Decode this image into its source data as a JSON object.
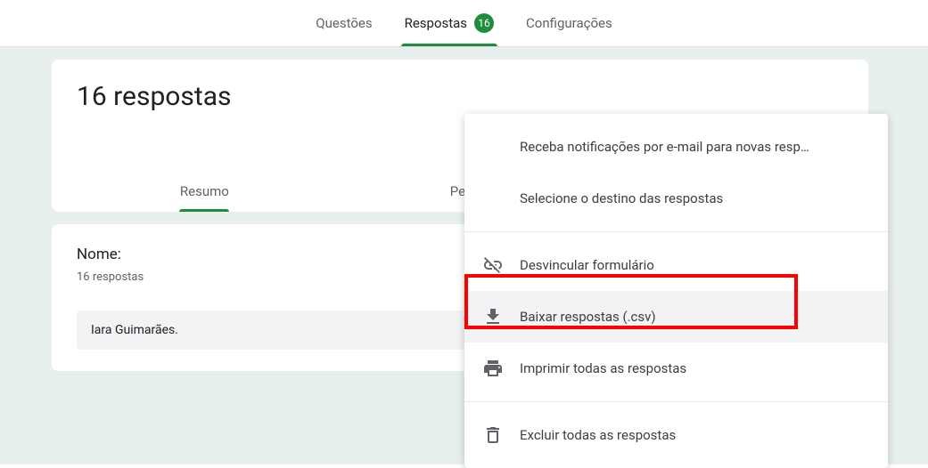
{
  "tabs": {
    "questions": "Questões",
    "responses": "Respostas",
    "responses_count": "16",
    "settings": "Configurações"
  },
  "card": {
    "title": "16 respostas",
    "subtabs": {
      "summary": "Resumo",
      "question_partial": "Per"
    }
  },
  "question": {
    "label": "Nome:",
    "sub": "16 respostas",
    "entry": "Iara Guimarães."
  },
  "menu": {
    "notif": "Receba notificações por e-mail para novas resp…",
    "dest": "Selecione o destino das respostas",
    "unlink": "Desvincular formulário",
    "download": "Baixar respostas (.csv)",
    "print": "Imprimir todas as respostas",
    "delete": "Excluir todas as respostas"
  }
}
